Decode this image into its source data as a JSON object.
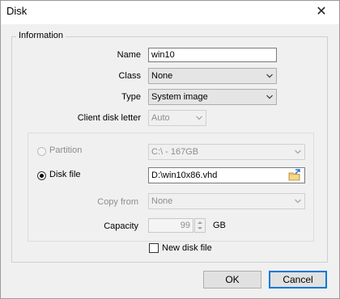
{
  "window": {
    "title": "Disk",
    "close_glyph": "✕"
  },
  "group": {
    "title": "Information"
  },
  "form": {
    "name_label": "Name",
    "name_value": "win10",
    "class_label": "Class",
    "class_value": "None",
    "type_label": "Type",
    "type_value": "System image",
    "client_disk_letter_label": "Client disk letter",
    "client_disk_letter_value": "Auto"
  },
  "source": {
    "partition_label": "Partition",
    "partition_value": "C:\\ - 167GB",
    "partition_selected": false,
    "disk_file_label": "Disk file",
    "disk_file_value": "D:\\win10x86.vhd",
    "disk_file_selected": true,
    "copy_from_label": "Copy from",
    "copy_from_value": "None",
    "capacity_label": "Capacity",
    "capacity_value": "99",
    "capacity_unit": "GB",
    "new_disk_file_label": "New disk file",
    "new_disk_file_checked": false
  },
  "buttons": {
    "ok": "OK",
    "cancel": "Cancel"
  },
  "colors": {
    "accent": "#0078d7",
    "dialog_bg": "#f0f0f0",
    "disabled_text": "#8d8d8d"
  },
  "icons": {
    "browse": "browse-folder-icon",
    "close": "close-icon",
    "dropdown": "chevron-down-icon"
  }
}
